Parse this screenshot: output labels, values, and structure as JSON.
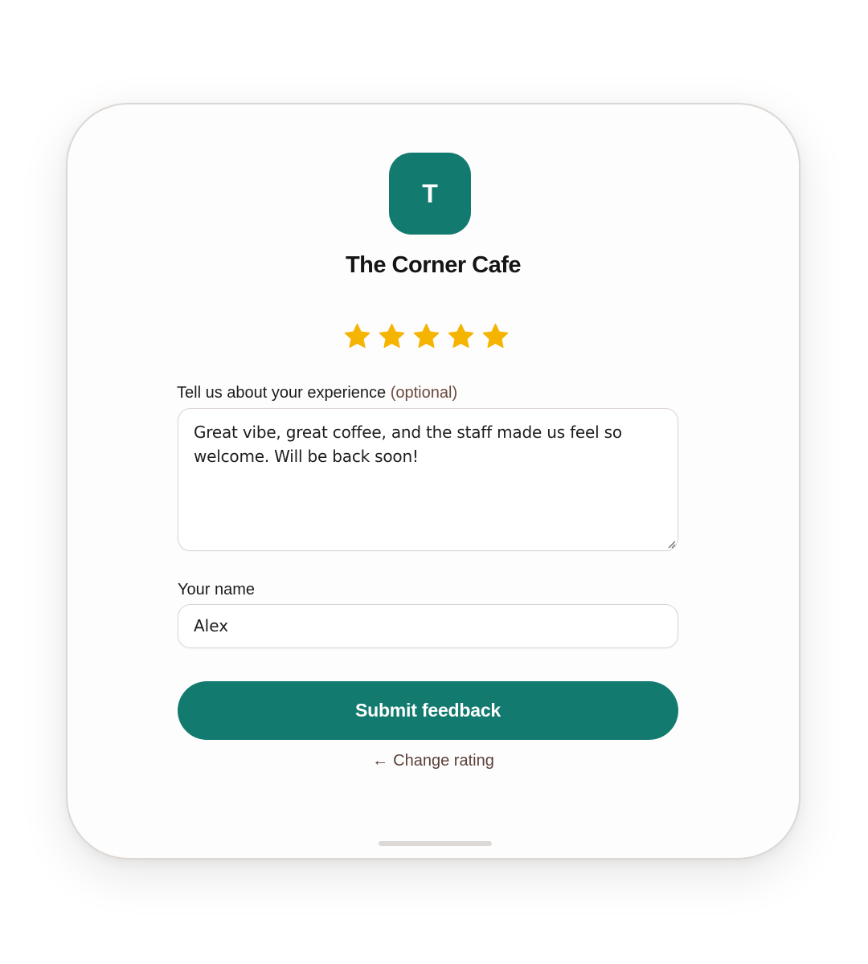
{
  "business": {
    "logo_letter": "T",
    "name": "The Corner Cafe",
    "brand_color": "#137a6f"
  },
  "rating": {
    "value": 5,
    "max": 5,
    "star_color": "#f5b400",
    "icon": "star-icon"
  },
  "experience": {
    "label": "Tell us about your experience",
    "optional_label": "(optional)",
    "value": "Great vibe, great coffee, and the staff made us feel so welcome. Will be back soon!"
  },
  "name_field": {
    "label": "Your name",
    "value": "Alex"
  },
  "actions": {
    "submit_label": "Submit feedback",
    "change_rating_arrow": "←",
    "change_rating_label": "Change rating"
  }
}
